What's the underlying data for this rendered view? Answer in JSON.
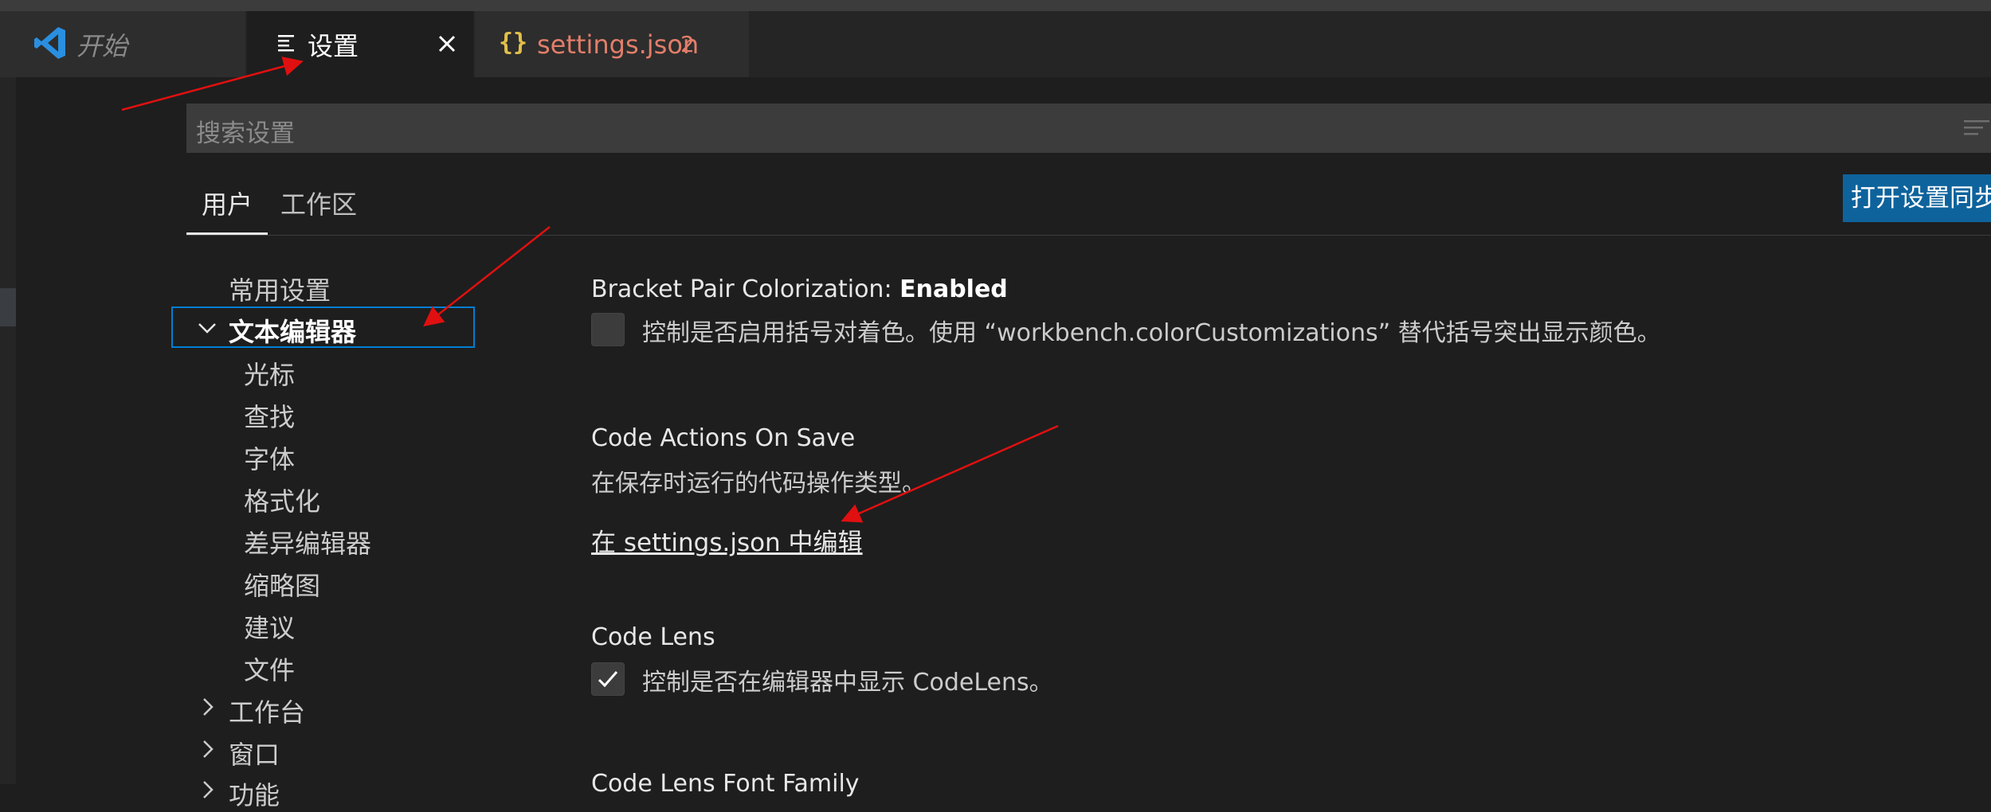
{
  "tabs": [
    {
      "label": "开始"
    },
    {
      "label": "设置"
    },
    {
      "label": "settings.json",
      "problem_count": "2"
    }
  ],
  "search": {
    "placeholder": "搜索设置"
  },
  "scope_tabs": {
    "user": "用户",
    "workspace": "工作区"
  },
  "sync_button": "打开设置同步",
  "toc": {
    "common": "常用设置",
    "text_editor": "文本编辑器",
    "children": [
      "光标",
      "查找",
      "字体",
      "格式化",
      "差异编辑器",
      "缩略图",
      "建议",
      "文件"
    ],
    "workbench": "工作台",
    "window": "窗口",
    "features": "功能"
  },
  "settings": {
    "bracket": {
      "title_prefix": "Bracket Pair Colorization: ",
      "title_strong": "Enabled",
      "description": "控制是否启用括号对着色。使用 “workbench.colorCustomizations” 替代括号突出显示颜色。",
      "checked": false
    },
    "code_actions": {
      "title": "Code Actions On Save",
      "description": "在保存时运行的代码操作类型。",
      "link": "在 settings.json 中编辑"
    },
    "code_lens": {
      "title": "Code Lens",
      "description": "控制是否在编辑器中显示 CodeLens。",
      "checked": true
    },
    "code_lens_font": {
      "title": "Code Lens Font Family"
    }
  },
  "colors": {
    "accent": "#007fd4",
    "button": "#0e639c",
    "annotation_arrow": "#e01010",
    "json_tab_text": "#e27e6a"
  },
  "icons": [
    "vscode-logo-icon",
    "settings-lines-icon",
    "close-icon",
    "json-braces-icon",
    "filter-icon",
    "chevron-down-icon",
    "chevron-right-icon",
    "checkmark-icon"
  ]
}
